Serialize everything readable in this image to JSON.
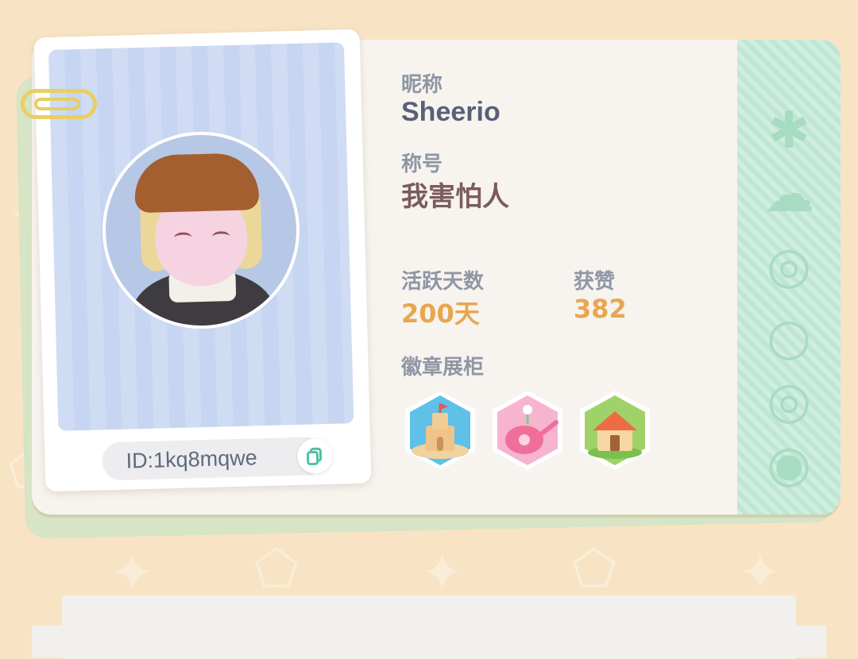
{
  "profile": {
    "nickname_label": "昵称",
    "nickname": "Sheerio",
    "title_label": "称号",
    "title": "我害怕人",
    "active_days_label": "活跃天数",
    "active_days": "200天",
    "likes_label": "获赞",
    "likes": "382",
    "badges_label": "徽章展柜",
    "id_text": "ID:1kq8mqwe"
  },
  "badges": [
    {
      "name": "sandcastle-badge",
      "color": "#5fc0e8"
    },
    {
      "name": "watering-can-badge",
      "color": "#f6b4cf"
    },
    {
      "name": "house-badge",
      "color": "#9fd36a"
    }
  ],
  "colors": {
    "background": "#f8e4c4",
    "card": "#f7f3ee",
    "stripe": "#cfeee0",
    "stat_accent": "#e8a651",
    "label": "#8f96a5"
  }
}
